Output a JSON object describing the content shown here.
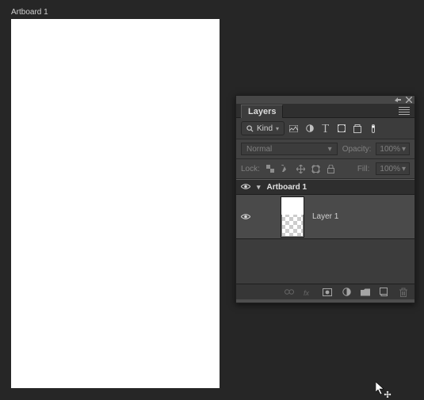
{
  "workspace": {
    "artboard_label": "Artboard 1"
  },
  "panel": {
    "title": "Layers",
    "filter": {
      "mode": "Kind"
    },
    "blend": {
      "mode": "Normal",
      "opacity_label": "Opacity:",
      "opacity_value": "100%"
    },
    "lock": {
      "label": "Lock:",
      "fill_label": "Fill:",
      "fill_value": "100%"
    },
    "tree": {
      "artboard": {
        "name": "Artboard 1"
      },
      "layers": [
        {
          "name": "Layer 1"
        }
      ]
    }
  }
}
